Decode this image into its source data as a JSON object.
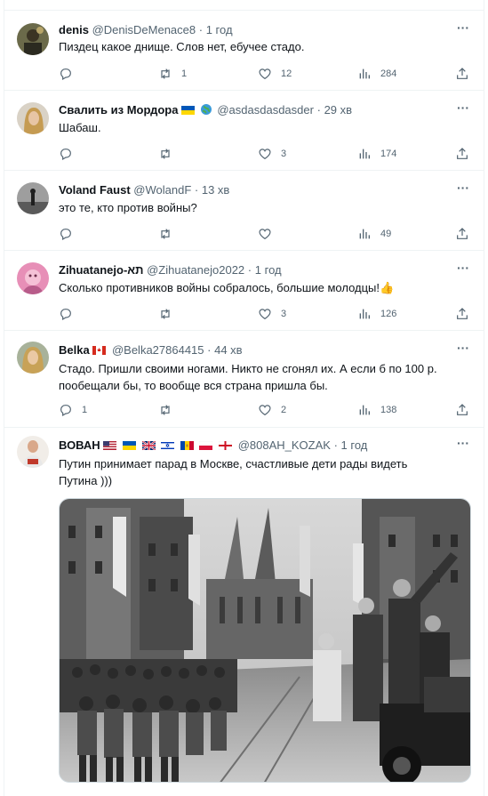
{
  "tweets": [
    {
      "name": "denis",
      "handle": "@DenisDeMenace8",
      "time": "1 год",
      "text": "Пиздец какое днище. Слов нет, ебучее стадо.",
      "replies": "",
      "retweets": "1",
      "likes": "12",
      "views": "284"
    },
    {
      "name": "Свалить из Мордора",
      "handle": "@asdasdasdasder",
      "time": "29 хв",
      "text": "Шабаш.",
      "replies": "",
      "retweets": "",
      "likes": "3",
      "views": "174"
    },
    {
      "name": "Voland Faust",
      "handle": "@WolandF",
      "time": "13 хв",
      "text": "это те, кто против войны?",
      "replies": "",
      "retweets": "",
      "likes": "",
      "views": "49"
    },
    {
      "name": "Zihuatanejo-תא",
      "handle": "@Zihuatanejo2022",
      "time": "1 год",
      "text": "Сколько противников войны собралось, большие молодцы!👍",
      "replies": "",
      "retweets": "",
      "likes": "3",
      "views": "126"
    },
    {
      "name": "Belka",
      "handle": "@Belka27864415",
      "time": "44 хв",
      "text": "Стадо. Пришли своими ногами. Никто не сгонял их. А если б по 100 р. пообещали бы, то вообще вся страна пришла бы.",
      "replies": "1",
      "retweets": "",
      "likes": "2",
      "views": "138"
    },
    {
      "name": "ВОВАН",
      "handle": "@808AH_KOZAK",
      "time": "1 год",
      "text": "Путин принимает парад в Москве, счастливые дети рады видеть Путина )))",
      "replies": "",
      "retweets": "",
      "likes": "",
      "views": ""
    }
  ],
  "separator": "·",
  "more_icon": "more-dots-icon",
  "colors": {
    "text": "#0f1419",
    "secondary": "#536471",
    "border": "#eff3f4"
  }
}
